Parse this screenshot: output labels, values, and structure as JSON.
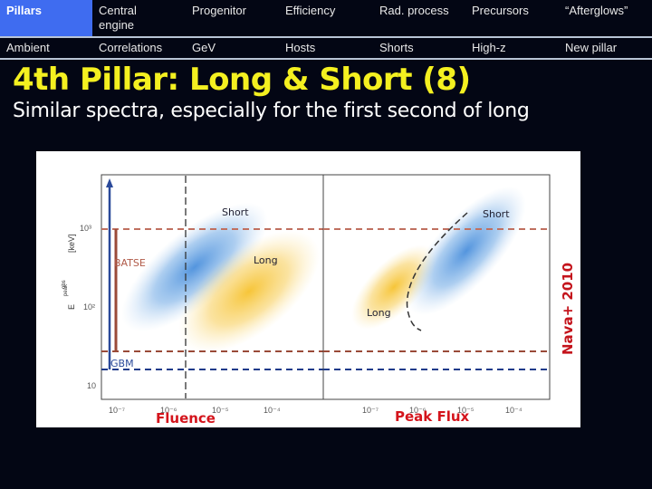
{
  "nav": {
    "row1": [
      {
        "label": "Pillars",
        "active": true
      },
      {
        "label": "Central\nengine"
      },
      {
        "label": "Progenitor"
      },
      {
        "label": "Efficiency"
      },
      {
        "label": "Rad. process"
      },
      {
        "label": "Precursors"
      },
      {
        "label": "“Afterglows”"
      }
    ],
    "row2": [
      {
        "label": "Ambient"
      },
      {
        "label": "Correlations"
      },
      {
        "label": "GeV"
      },
      {
        "label": "Hosts"
      },
      {
        "label": "Shorts"
      },
      {
        "label": "High-z"
      },
      {
        "label": "New pillar"
      }
    ]
  },
  "slide": {
    "title": "4th Pillar: Long & Short (8)",
    "subtitle": "Similar spectra, especially for the first second of long"
  },
  "colors": {
    "nav_active_bg": "#3f6cf0",
    "title": "#f4f020",
    "short_blob": "#4a8fdc",
    "long_blob": "#f6c22e",
    "batse": "#a04a3a",
    "gbm": "#1f3b8a",
    "axis_label": "#d4141c"
  },
  "chart_data": [
    {
      "type": "scatter",
      "title": "",
      "xlabel": "Fluence",
      "ylabel": "E_peak^obs [keV]",
      "x_ticks": [
        "10⁻⁷",
        "10⁻⁶",
        "10⁻⁵",
        "10⁻⁴"
      ],
      "y_ticks": [
        "10",
        "10²",
        "10³"
      ],
      "xlim_log10": [
        -7.3,
        -3.3
      ],
      "ylim_log10": [
        1,
        3.9
      ],
      "regions": [
        {
          "name": "Short",
          "label": "Short",
          "center_log10": [
            -5.6,
            2.85
          ]
        },
        {
          "name": "Long",
          "label": "Long",
          "center_log10": [
            -4.9,
            2.25
          ]
        }
      ],
      "instrument_ranges": [
        {
          "name": "BATSE",
          "ymin": 70,
          "ymax": 1000
        },
        {
          "name": "GBM",
          "ymin": 40,
          "ymax": 10000
        }
      ],
      "vertical_reference_log10": -5.9
    },
    {
      "type": "scatter",
      "title": "",
      "xlabel": "Peak Flux",
      "ylabel": "",
      "x_ticks": [
        "10⁻⁷",
        "10⁻⁶",
        "10⁻⁵",
        "10⁻⁴"
      ],
      "xlim_log10": [
        -8.2,
        -3.6
      ],
      "ylim_log10": [
        1,
        3.9
      ],
      "regions": [
        {
          "name": "Short",
          "label": "Short",
          "center_log10": [
            -5.9,
            2.7
          ]
        },
        {
          "name": "Long",
          "label": "Long",
          "center_log10": [
            -6.9,
            2.05
          ]
        }
      ],
      "horizontal_limits": [
        {
          "name": "BATSE",
          "values": [
            70,
            1000
          ]
        },
        {
          "name": "GBM",
          "values": [
            40
          ]
        }
      ]
    }
  ],
  "figure": {
    "credit": "Nava+ 2010",
    "ytick_labels": [
      "10³",
      "10²",
      "10"
    ],
    "ylabel_unit": "[keV]",
    "ylabel_symbol": "E",
    "ylabel_sub": "peak",
    "ylabel_sup": "obs",
    "batse_label": "BATSE",
    "gbm_label": "GBM",
    "left_short_label": "Short",
    "left_long_label": "Long",
    "right_short_label": "Short",
    "right_long_label": "Long",
    "left_xlabel": "Fluence",
    "right_xlabel": "Peak Flux",
    "left_xticks": [
      "10⁻⁷",
      "10⁻⁶",
      "10⁻⁵",
      "10⁻⁴"
    ],
    "right_xticks": [
      "10⁻⁷",
      "10⁻⁶",
      "10⁻⁵",
      "10⁻⁴"
    ]
  }
}
